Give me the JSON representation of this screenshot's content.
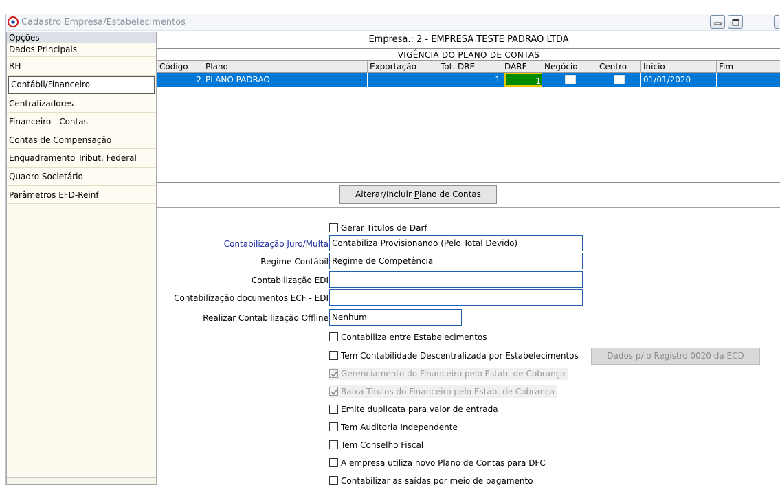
{
  "window": {
    "title": "Cadastro Empresa/Estabelecimentos"
  },
  "sidebar": {
    "header": "Opções",
    "items": [
      {
        "label": "Dados Principais"
      },
      {
        "label": "RH"
      },
      {
        "label": "Contábil/Financeiro"
      },
      {
        "label": "Centralizadores"
      },
      {
        "label": "Financeiro - Contas"
      },
      {
        "label": "Contas de Compensação"
      },
      {
        "label": "Enquadramento Tribut. Federal"
      },
      {
        "label": "Quadro Societário"
      },
      {
        "label": "Parâmetros EFD-Reinf"
      }
    ],
    "selected": "Contábil/Financeiro"
  },
  "empresa_label": "Empresa.: 2 - EMPRESA TESTE  PADRAO LTDA",
  "grid": {
    "title": "VIGÊNCIA DO PLANO DE CONTAS",
    "columns": [
      "Código",
      "Plano",
      "Exportação",
      "Tot. DRE",
      "DARF",
      "Negócio",
      "Centro",
      "Inicio",
      "Fim"
    ],
    "rows": [
      {
        "codigo": "2",
        "plano": "PLANO PADRAO",
        "exportacao": "",
        "tot_dre": "1",
        "darf": "1",
        "negocio": false,
        "centro": false,
        "inicio": "01/01/2020",
        "fim": ""
      }
    ]
  },
  "buttons": {
    "alterar_prefix": "Alterar/Incluir ",
    "alterar_underline": "P",
    "alterar_suffix": "lano de Contas",
    "dados_ecd": "Dados p/ o Registro 0020 da ECD"
  },
  "form": {
    "gerar_titulos_darf": {
      "label": "Gerar Titulos de Darf",
      "checked": false
    },
    "contab_juro_multa": {
      "label": "Contabilização Juro/Multa",
      "value": "Contabiliza Provisionando (Pelo Total Devido)"
    },
    "regime_contabil": {
      "label": "Regime Contábil",
      "value": "Regime de Competência"
    },
    "contab_edi": {
      "label": "Contabilização EDI",
      "value": ""
    },
    "contab_ecf_edi": {
      "label": "Contabilização documentos ECF - EDI",
      "value": ""
    },
    "contab_offline": {
      "label": "Realizar Contabilização Offline",
      "value": "Nenhum"
    },
    "checks": [
      {
        "label": "Contabiliza entre Estabelecimentos",
        "checked": false,
        "disabled": false
      },
      {
        "label": "Tem Contabilidade Descentralizada por Estabelecimentos",
        "checked": false,
        "disabled": false
      },
      {
        "label": "Gerenciamento do Financeiro pelo Estab. de Cobrança",
        "checked": true,
        "disabled": true
      },
      {
        "label": "Baixa Titulos do Financeiro pelo Estab. de Cobrança",
        "checked": true,
        "disabled": true
      },
      {
        "label": "Emite duplicata para valor de entrada",
        "checked": false,
        "disabled": false
      },
      {
        "label": "Tem Auditoria Independente",
        "checked": false,
        "disabled": false
      },
      {
        "label": "Tem Conselho Fiscal",
        "checked": false,
        "disabled": false
      },
      {
        "label": "A empresa utiliza novo Plano de Contas para DFC",
        "checked": false,
        "disabled": false
      },
      {
        "label": "Contabilizar as saídas por meio de pagamento",
        "checked": false,
        "disabled": false
      }
    ]
  },
  "colors": {
    "selection": "#0078d7",
    "darf_cell": "#008a00",
    "annotation_arrow": "#e0161b",
    "label_blue": "#1f2d9f"
  }
}
